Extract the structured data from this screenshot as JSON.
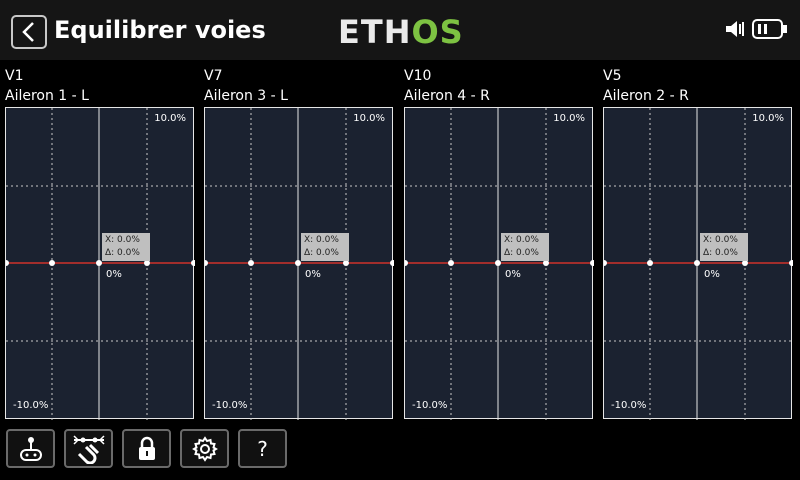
{
  "header": {
    "title": "Equilibrer voies",
    "logo_part1": "ETH",
    "logo_part2": "OS"
  },
  "channels": [
    {
      "id": "V1",
      "name": "Aileron 1 - L"
    },
    {
      "id": "V7",
      "name": "Aileron 3 - L"
    },
    {
      "id": "V10",
      "name": "Aileron 4 - R"
    },
    {
      "id": "V5",
      "name": "Aileron 2 - R"
    }
  ],
  "graph": {
    "top_label": "10.0%",
    "bottom_label": "-10.0%",
    "zero_label": "0%",
    "x_readout": "X: 0.0%",
    "delta_readout": "Δ: 0.0%"
  },
  "toolbar": {
    "help_label": "?"
  },
  "colors": {
    "curve": "#d0322b",
    "graph_bg": "#1b2230",
    "logo_accent": "#7dc242"
  }
}
